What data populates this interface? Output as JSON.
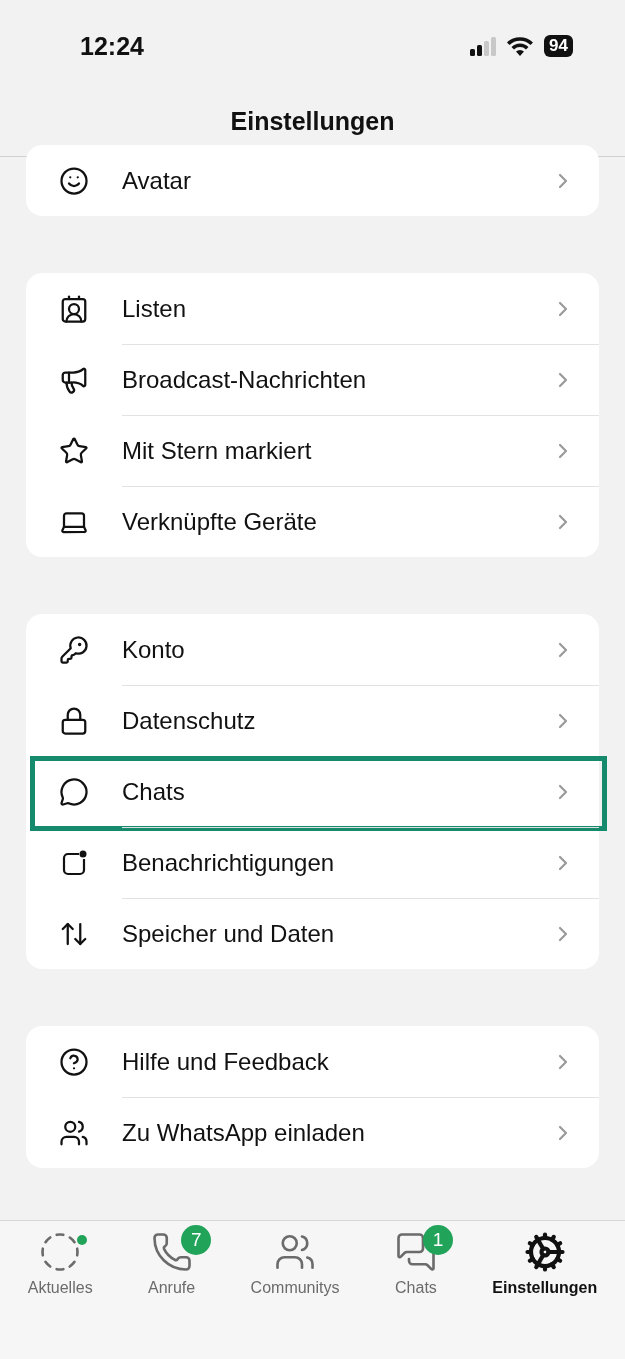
{
  "status_bar": {
    "time": "12:24",
    "battery": "94"
  },
  "header": {
    "title": "Einstellungen"
  },
  "groups": [
    {
      "items": [
        {
          "kind": "avatar",
          "label": "Avatar",
          "highlighted": false
        }
      ]
    },
    {
      "items": [
        {
          "kind": "lists",
          "label": "Listen",
          "highlighted": false
        },
        {
          "kind": "broadcast",
          "label": "Broadcast-Nachrichten",
          "highlighted": false
        },
        {
          "kind": "starred",
          "label": "Mit Stern markiert",
          "highlighted": false
        },
        {
          "kind": "devices",
          "label": "Verknüpfte Geräte",
          "highlighted": false
        }
      ]
    },
    {
      "items": [
        {
          "kind": "account",
          "label": "Konto",
          "highlighted": false
        },
        {
          "kind": "privacy",
          "label": "Datenschutz",
          "highlighted": false
        },
        {
          "kind": "chats",
          "label": "Chats",
          "highlighted": true
        },
        {
          "kind": "notifications",
          "label": "Benachrichtigungen",
          "highlighted": false
        },
        {
          "kind": "storage",
          "label": "Speicher und Daten",
          "highlighted": false
        }
      ]
    },
    {
      "items": [
        {
          "kind": "help",
          "label": "Hilfe und Feedback",
          "highlighted": false
        },
        {
          "kind": "invite",
          "label": "Zu WhatsApp einladen",
          "highlighted": false
        }
      ]
    }
  ],
  "tab_bar": [
    {
      "kind": "updates",
      "label": "Aktuelles",
      "selected": false,
      "dot": true
    },
    {
      "kind": "calls",
      "label": "Anrufe",
      "selected": false,
      "badge": "7"
    },
    {
      "kind": "communities",
      "label": "Communitys",
      "selected": false
    },
    {
      "kind": "chats",
      "label": "Chats",
      "selected": false,
      "badge": "1"
    },
    {
      "kind": "settings",
      "label": "Einstellungen",
      "selected": true
    }
  ]
}
